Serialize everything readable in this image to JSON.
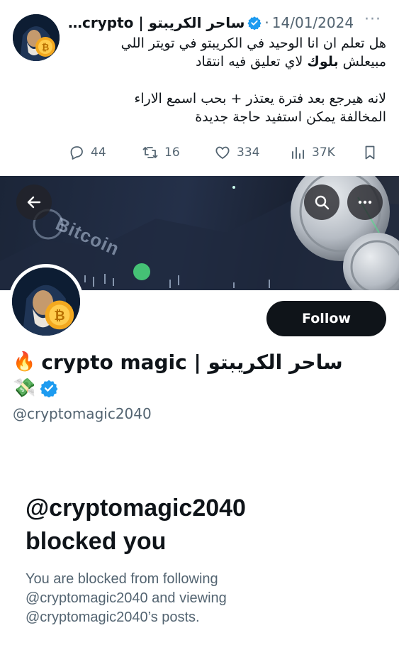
{
  "tweet": {
    "author_name": "…crypto | ساحر الكريبتو",
    "date": "14/01/2024",
    "separator_dot": "·",
    "more_icon": "more-dots-icon",
    "text_line1": "هل تعلم ان انا الوحيد في الكريبتو في تويتر اللي",
    "text_line2_part1": "مبيعلش",
    "text_line2_bold": "بلوك",
    "text_line2_part2": "لاي تعليق فيه انتقاد",
    "text_line3": "لانه هيرجع بعد فترة يعتذر + بحب اسمع الاراء",
    "text_line4": "المخالفة يمكن استفيد حاجة جديدة",
    "actions": {
      "replies": "44",
      "retweets": "16",
      "likes": "334",
      "views": "37K"
    }
  },
  "banner": {
    "watermark_text": "Bitcoin",
    "back_icon": "back-arrow-icon",
    "search_icon": "search-icon",
    "more_icon": "more-dots-icon"
  },
  "profile": {
    "name": "crypto magic | ساحر الكريبتو",
    "fire_emoji": "🔥",
    "money_emoji": "💸",
    "verified_icon": "verified-badge-icon",
    "handle": "@cryptomagic2040",
    "follow_label": "Follow"
  },
  "blocked": {
    "title_line1": "@cryptomagic2040",
    "title_line2": "blocked you",
    "desc_line1": "You are blocked from following",
    "desc_line2": "@cryptomagic2040 and viewing",
    "desc_line3": "@cryptomagic2040’s posts."
  },
  "colors": {
    "verified": "#1d9bf0",
    "text_primary": "#0f1419",
    "text_secondary": "#536471",
    "follow_bg": "#0f1419"
  }
}
